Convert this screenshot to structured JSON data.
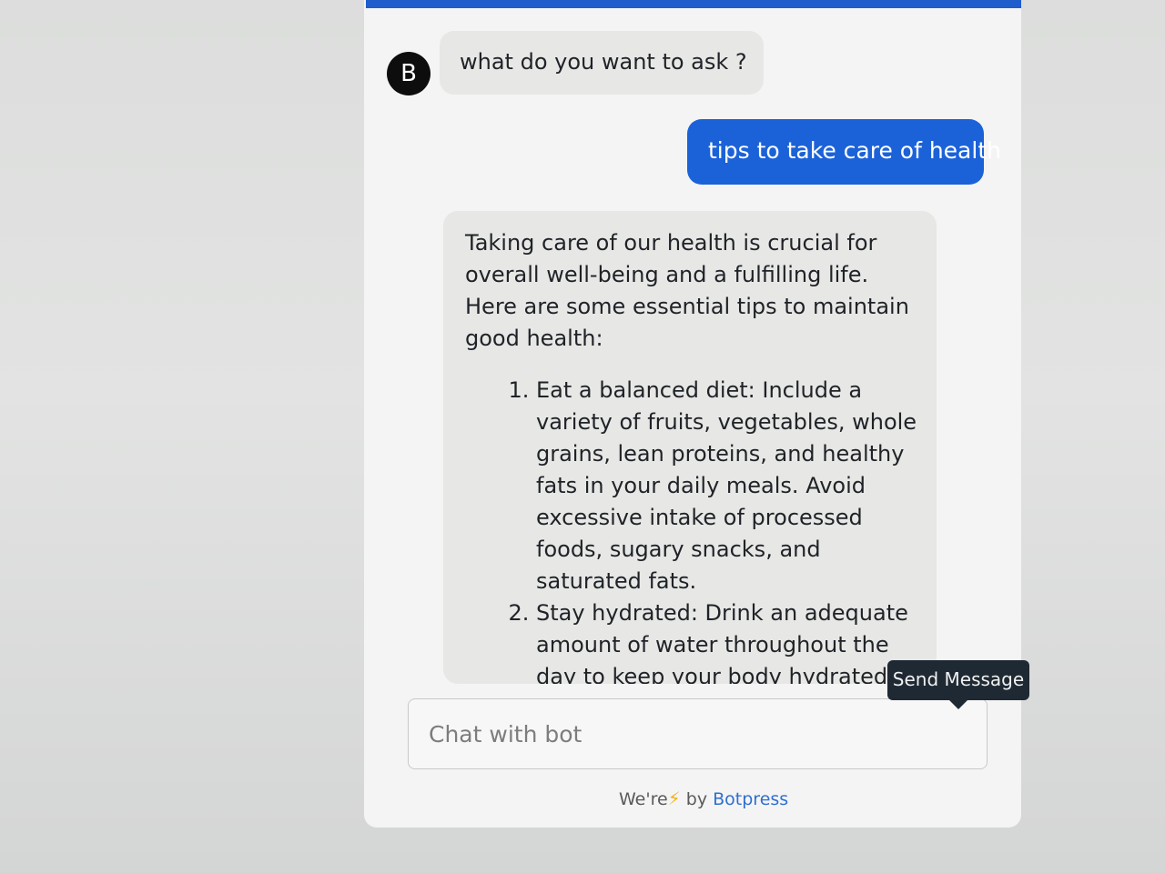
{
  "avatar": {
    "initial": "B"
  },
  "messages": {
    "bot_greeting": "what do you want to ask ?",
    "user_message": "tips to take care of health",
    "bot_reply": {
      "intro": "Taking care of our health is crucial for overall well-being and a fulfilling life. Here are some essential tips to maintain good health:",
      "tips": [
        "Eat a balanced diet: Include a variety of fruits, vegetables, whole grains, lean proteins, and healthy fats in your daily meals. Avoid excessive intake of processed foods, sugary snacks, and saturated fats.",
        "Stay hydrated: Drink an adequate amount of water throughout the day to keep your body hydrated. Water helps in digestion,"
      ]
    }
  },
  "composer": {
    "placeholder": "Chat with bot",
    "tooltip": "Send Message"
  },
  "footer": {
    "prefix": "We're",
    "bolt": "⚡",
    "by": "by",
    "brand": "Botpress"
  },
  "colors": {
    "accent": "#1b62d9",
    "bot_bubble": "#e7e7e6",
    "tooltip_bg": "#1e2933"
  },
  "icons": {
    "bolt": "lightning-bolt-icon"
  }
}
